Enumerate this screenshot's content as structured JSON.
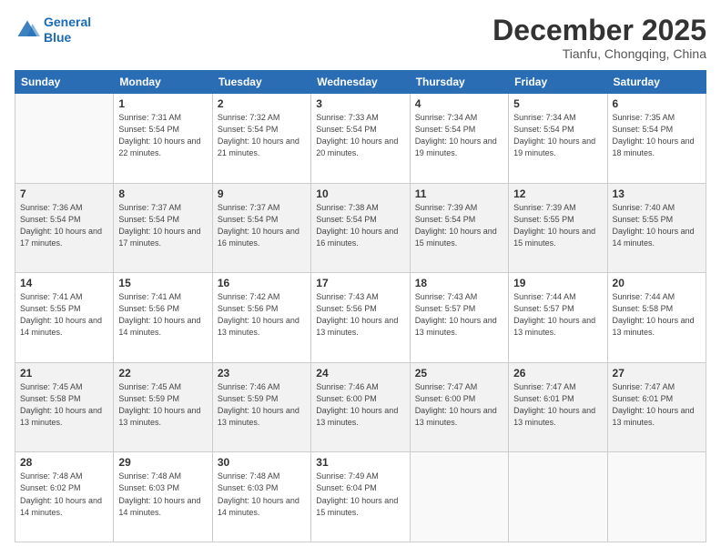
{
  "logo": {
    "line1": "General",
    "line2": "Blue"
  },
  "title": "December 2025",
  "location": "Tianfu, Chongqing, China",
  "weekdays": [
    "Sunday",
    "Monday",
    "Tuesday",
    "Wednesday",
    "Thursday",
    "Friday",
    "Saturday"
  ],
  "weeks": [
    [
      {
        "day": "",
        "sunrise": "",
        "sunset": "",
        "daylight": ""
      },
      {
        "day": "1",
        "sunrise": "Sunrise: 7:31 AM",
        "sunset": "Sunset: 5:54 PM",
        "daylight": "Daylight: 10 hours and 22 minutes."
      },
      {
        "day": "2",
        "sunrise": "Sunrise: 7:32 AM",
        "sunset": "Sunset: 5:54 PM",
        "daylight": "Daylight: 10 hours and 21 minutes."
      },
      {
        "day": "3",
        "sunrise": "Sunrise: 7:33 AM",
        "sunset": "Sunset: 5:54 PM",
        "daylight": "Daylight: 10 hours and 20 minutes."
      },
      {
        "day": "4",
        "sunrise": "Sunrise: 7:34 AM",
        "sunset": "Sunset: 5:54 PM",
        "daylight": "Daylight: 10 hours and 19 minutes."
      },
      {
        "day": "5",
        "sunrise": "Sunrise: 7:34 AM",
        "sunset": "Sunset: 5:54 PM",
        "daylight": "Daylight: 10 hours and 19 minutes."
      },
      {
        "day": "6",
        "sunrise": "Sunrise: 7:35 AM",
        "sunset": "Sunset: 5:54 PM",
        "daylight": "Daylight: 10 hours and 18 minutes."
      }
    ],
    [
      {
        "day": "7",
        "sunrise": "Sunrise: 7:36 AM",
        "sunset": "Sunset: 5:54 PM",
        "daylight": "Daylight: 10 hours and 17 minutes."
      },
      {
        "day": "8",
        "sunrise": "Sunrise: 7:37 AM",
        "sunset": "Sunset: 5:54 PM",
        "daylight": "Daylight: 10 hours and 17 minutes."
      },
      {
        "day": "9",
        "sunrise": "Sunrise: 7:37 AM",
        "sunset": "Sunset: 5:54 PM",
        "daylight": "Daylight: 10 hours and 16 minutes."
      },
      {
        "day": "10",
        "sunrise": "Sunrise: 7:38 AM",
        "sunset": "Sunset: 5:54 PM",
        "daylight": "Daylight: 10 hours and 16 minutes."
      },
      {
        "day": "11",
        "sunrise": "Sunrise: 7:39 AM",
        "sunset": "Sunset: 5:54 PM",
        "daylight": "Daylight: 10 hours and 15 minutes."
      },
      {
        "day": "12",
        "sunrise": "Sunrise: 7:39 AM",
        "sunset": "Sunset: 5:55 PM",
        "daylight": "Daylight: 10 hours and 15 minutes."
      },
      {
        "day": "13",
        "sunrise": "Sunrise: 7:40 AM",
        "sunset": "Sunset: 5:55 PM",
        "daylight": "Daylight: 10 hours and 14 minutes."
      }
    ],
    [
      {
        "day": "14",
        "sunrise": "Sunrise: 7:41 AM",
        "sunset": "Sunset: 5:55 PM",
        "daylight": "Daylight: 10 hours and 14 minutes."
      },
      {
        "day": "15",
        "sunrise": "Sunrise: 7:41 AM",
        "sunset": "Sunset: 5:56 PM",
        "daylight": "Daylight: 10 hours and 14 minutes."
      },
      {
        "day": "16",
        "sunrise": "Sunrise: 7:42 AM",
        "sunset": "Sunset: 5:56 PM",
        "daylight": "Daylight: 10 hours and 13 minutes."
      },
      {
        "day": "17",
        "sunrise": "Sunrise: 7:43 AM",
        "sunset": "Sunset: 5:56 PM",
        "daylight": "Daylight: 10 hours and 13 minutes."
      },
      {
        "day": "18",
        "sunrise": "Sunrise: 7:43 AM",
        "sunset": "Sunset: 5:57 PM",
        "daylight": "Daylight: 10 hours and 13 minutes."
      },
      {
        "day": "19",
        "sunrise": "Sunrise: 7:44 AM",
        "sunset": "Sunset: 5:57 PM",
        "daylight": "Daylight: 10 hours and 13 minutes."
      },
      {
        "day": "20",
        "sunrise": "Sunrise: 7:44 AM",
        "sunset": "Sunset: 5:58 PM",
        "daylight": "Daylight: 10 hours and 13 minutes."
      }
    ],
    [
      {
        "day": "21",
        "sunrise": "Sunrise: 7:45 AM",
        "sunset": "Sunset: 5:58 PM",
        "daylight": "Daylight: 10 hours and 13 minutes."
      },
      {
        "day": "22",
        "sunrise": "Sunrise: 7:45 AM",
        "sunset": "Sunset: 5:59 PM",
        "daylight": "Daylight: 10 hours and 13 minutes."
      },
      {
        "day": "23",
        "sunrise": "Sunrise: 7:46 AM",
        "sunset": "Sunset: 5:59 PM",
        "daylight": "Daylight: 10 hours and 13 minutes."
      },
      {
        "day": "24",
        "sunrise": "Sunrise: 7:46 AM",
        "sunset": "Sunset: 6:00 PM",
        "daylight": "Daylight: 10 hours and 13 minutes."
      },
      {
        "day": "25",
        "sunrise": "Sunrise: 7:47 AM",
        "sunset": "Sunset: 6:00 PM",
        "daylight": "Daylight: 10 hours and 13 minutes."
      },
      {
        "day": "26",
        "sunrise": "Sunrise: 7:47 AM",
        "sunset": "Sunset: 6:01 PM",
        "daylight": "Daylight: 10 hours and 13 minutes."
      },
      {
        "day": "27",
        "sunrise": "Sunrise: 7:47 AM",
        "sunset": "Sunset: 6:01 PM",
        "daylight": "Daylight: 10 hours and 13 minutes."
      }
    ],
    [
      {
        "day": "28",
        "sunrise": "Sunrise: 7:48 AM",
        "sunset": "Sunset: 6:02 PM",
        "daylight": "Daylight: 10 hours and 14 minutes."
      },
      {
        "day": "29",
        "sunrise": "Sunrise: 7:48 AM",
        "sunset": "Sunset: 6:03 PM",
        "daylight": "Daylight: 10 hours and 14 minutes."
      },
      {
        "day": "30",
        "sunrise": "Sunrise: 7:48 AM",
        "sunset": "Sunset: 6:03 PM",
        "daylight": "Daylight: 10 hours and 14 minutes."
      },
      {
        "day": "31",
        "sunrise": "Sunrise: 7:49 AM",
        "sunset": "Sunset: 6:04 PM",
        "daylight": "Daylight: 10 hours and 15 minutes."
      },
      {
        "day": "",
        "sunrise": "",
        "sunset": "",
        "daylight": ""
      },
      {
        "day": "",
        "sunrise": "",
        "sunset": "",
        "daylight": ""
      },
      {
        "day": "",
        "sunrise": "",
        "sunset": "",
        "daylight": ""
      }
    ]
  ]
}
